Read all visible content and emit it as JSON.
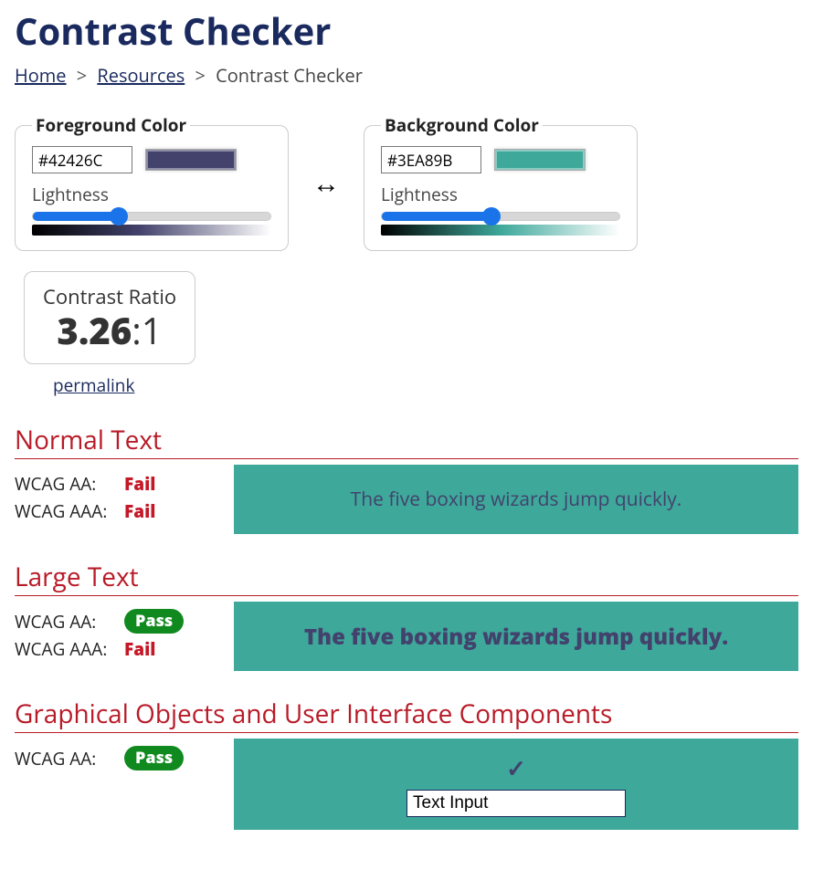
{
  "title": "Contrast Checker",
  "breadcrumb": {
    "home": "Home",
    "resources": "Resources",
    "current": "Contrast Checker"
  },
  "foreground": {
    "legend": "Foreground Color",
    "hex": "#42426C",
    "lightness_label": "Lightness",
    "lightness_pct": 36,
    "gradient_css": "linear-gradient(to right, #000000, #42426C 45%, #ffffff)"
  },
  "background": {
    "legend": "Background Color",
    "hex": "#3EA89B",
    "lightness_label": "Lightness",
    "lightness_pct": 46,
    "gradient_css": "linear-gradient(to right, #000000, #3EA89B 50%, #ffffff)"
  },
  "ratio": {
    "label": "Contrast Ratio",
    "value": "3.26",
    "suffix": ":1"
  },
  "permalink": "permalink",
  "sections": {
    "normal": {
      "title": "Normal Text",
      "aa_label": "WCAG AA:",
      "aa_result": "Fail",
      "aa_pass": false,
      "aaa_label": "WCAG AAA:",
      "aaa_result": "Fail",
      "aaa_pass": false,
      "sample": "The five boxing wizards jump quickly."
    },
    "large": {
      "title": "Large Text",
      "aa_label": "WCAG AA:",
      "aa_result": "Pass",
      "aa_pass": true,
      "aaa_label": "WCAG AAA:",
      "aaa_result": "Fail",
      "aaa_pass": false,
      "sample": "The five boxing wizards jump quickly."
    },
    "ui": {
      "title": "Graphical Objects and User Interface Components",
      "aa_label": "WCAG AA:",
      "aa_result": "Pass",
      "aa_pass": true,
      "input_value": "Text Input"
    }
  }
}
